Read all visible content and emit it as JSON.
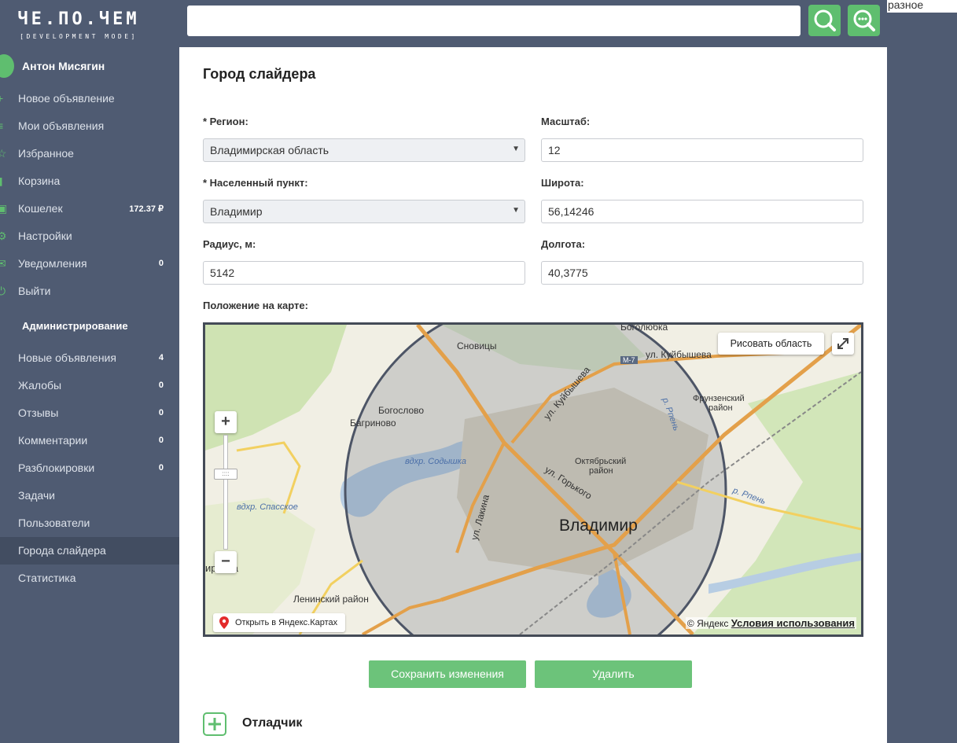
{
  "header": {
    "logo_title": "ЧЕ.ПО.ЧЕМ",
    "logo_subtitle": "[DEVELOPMENT MODE]",
    "search_placeholder": "",
    "search_icon": "search-icon",
    "advanced_search_icon": "search-dots-icon",
    "top_right_text": "разное"
  },
  "sidebar": {
    "user_name": "Антон Мисягин",
    "items": [
      {
        "label": "Новое объявление",
        "icon": "plus-icon",
        "badge": ""
      },
      {
        "label": "Мои объявления",
        "icon": "list-icon",
        "badge": ""
      },
      {
        "label": "Избранное",
        "icon": "star-icon",
        "badge": ""
      },
      {
        "label": "Корзина",
        "icon": "trash-icon",
        "badge": ""
      },
      {
        "label": "Кошелек",
        "icon": "wallet-icon",
        "badge": "172.37 ₽"
      },
      {
        "label": "Настройки",
        "icon": "gear-icon",
        "badge": ""
      },
      {
        "label": "Уведомления",
        "icon": "mail-icon",
        "badge": "0"
      },
      {
        "label": "Выйти",
        "icon": "power-icon",
        "badge": ""
      }
    ],
    "admin_heading": "Администрирование",
    "admin_items": [
      {
        "label": "Новые объявления",
        "badge": "4"
      },
      {
        "label": "Жалобы",
        "badge": "0"
      },
      {
        "label": "Отзывы",
        "badge": "0"
      },
      {
        "label": "Комментарии",
        "badge": "0"
      },
      {
        "label": "Разблокировки",
        "badge": "0"
      },
      {
        "label": "Задачи",
        "badge": ""
      },
      {
        "label": "Пользователи",
        "badge": ""
      },
      {
        "label": "Города слайдера",
        "badge": "",
        "active": true
      },
      {
        "label": "Статистика",
        "badge": ""
      }
    ]
  },
  "form": {
    "title": "Город слайдера",
    "region_label": "* Регион:",
    "region_value": "Владимирская область",
    "scale_label": "Масштаб:",
    "scale_value": "12",
    "locality_label": "* Населенный пункт:",
    "locality_value": "Владимир",
    "lat_label": "Широта:",
    "lat_value": "56,14246",
    "radius_label": "Радиус, м:",
    "radius_value": "5142",
    "lon_label": "Долгота:",
    "lon_value": "40,3775",
    "map_label": "Положение на карте:"
  },
  "map": {
    "draw_area_button": "Рисовать область",
    "open_yandex": "Открыть в Яндекс.Картах",
    "copyright": "© Яндекс",
    "terms": "Условия использования",
    "labels": {
      "snovitsy": "Сновицы",
      "bogoslovo": "Богослово",
      "bagrinovo": "Багриново",
      "sodyshka": "вдхр. Содышка",
      "spasskoe": "вдхр. Спасское",
      "vladimir": "Владимир",
      "oktyabrsky1": "Октябрьский",
      "oktyabrsky2": "район",
      "frunzensky1": "Фрунзенский",
      "frunzensky2": "район",
      "leninsky": "Ленинский район",
      "kuibysheva1": "ул. Куйбышева",
      "kuibysheva2": "ул. Куйбышева",
      "gorkogo": "ул. Горького",
      "lakina": "ул. Лакина",
      "rpen1": "р. Рпень",
      "rpen2": "р. Рпень",
      "bogolyubka": "Боголюбка",
      "m7": "М-7",
      "irovka": "ировка"
    }
  },
  "actions": {
    "save": "Сохранить изменения",
    "delete": "Удалить"
  },
  "debugger": {
    "label": "Отладчик"
  }
}
